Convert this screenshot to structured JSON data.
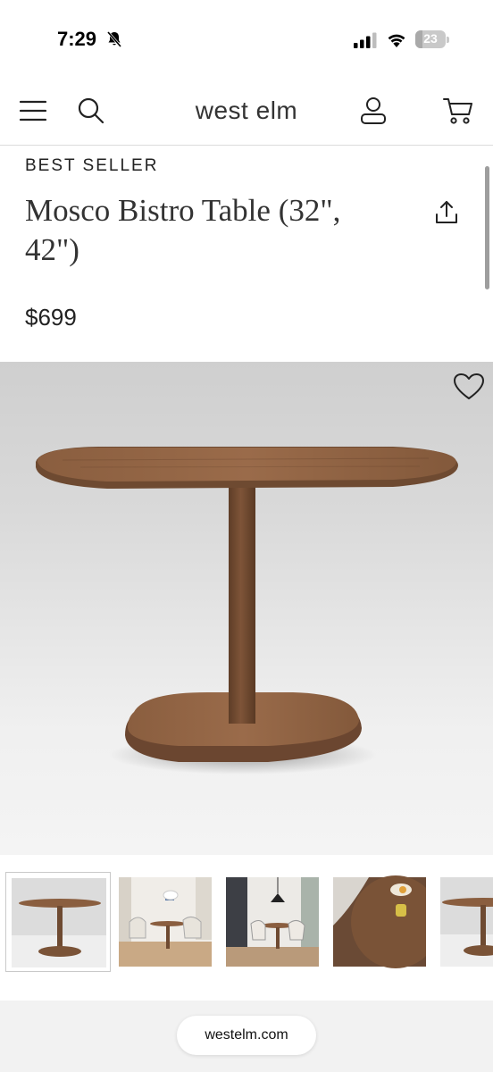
{
  "status_bar": {
    "time": "7:29",
    "battery_level": "23",
    "battery_fraction": 0.23,
    "icons": [
      "bell-slash-icon",
      "signal-icon",
      "wifi-icon",
      "battery-icon"
    ]
  },
  "header": {
    "brand": "west elm",
    "icons": [
      "hamburger-menu-icon",
      "search-icon",
      "account-icon",
      "cart-icon"
    ]
  },
  "product": {
    "badge": "BEST SELLER",
    "title": "Mosco Bistro Table (32\", 42\")",
    "price": "$699",
    "share_icon": "share-icon",
    "favorite_icon": "heart-icon"
  },
  "gallery": {
    "thumbnail_count": 5,
    "active_index": 0
  },
  "browser": {
    "url": "westelm.com"
  },
  "colors": {
    "wood": "#7a5337",
    "wood_light": "#94694a",
    "wood_dark": "#5a3a24",
    "divider": "#dcdcdc",
    "bottom_bar": "#f2f2f2"
  }
}
